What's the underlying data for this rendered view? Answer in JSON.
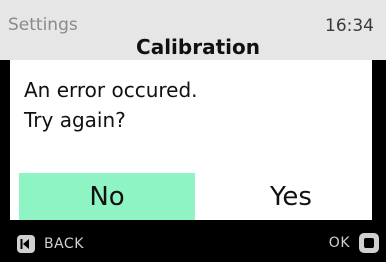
{
  "header": {
    "section": "Settings",
    "time": "16:34",
    "title": "Calibration"
  },
  "dialog": {
    "message_lines": [
      "An error occured.",
      "Try again?"
    ],
    "buttons": {
      "no": "No",
      "yes": "Yes"
    },
    "selected_button": "No",
    "selected_color": "#8ff4c3"
  },
  "footer": {
    "back_label": "BACK",
    "back_icon": "back-icon",
    "ok_label": "OK",
    "ok_icon": "ok-square-icon"
  }
}
